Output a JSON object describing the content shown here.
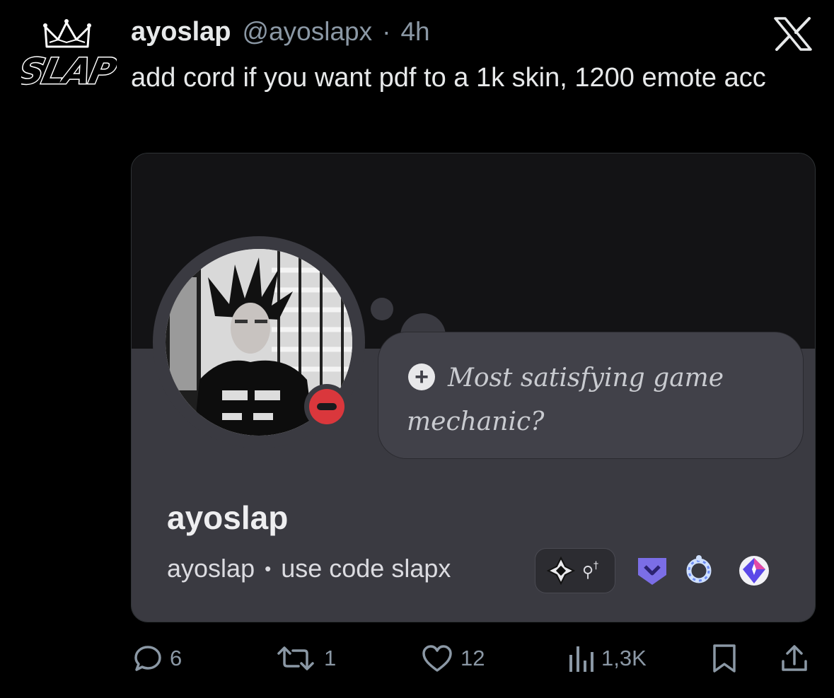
{
  "tweet": {
    "display_name": "ayoslap",
    "handle": "@ayoslapx",
    "separator": "·",
    "time": "4h",
    "text": "add cord if you want pdf to a 1k skin, 1200 emote acc"
  },
  "avatar": {
    "logo_text": "SLAP"
  },
  "profile_card": {
    "note": "Most satisfying game mechanic?",
    "name": "ayoslap",
    "username": "ayoslap",
    "bullet": "•",
    "custom_status": "use code slapx",
    "status": "do-not-disturb",
    "badges": [
      "guild-tag-icon",
      "nitro-shield-badge-icon",
      "boost-laurel-badge-icon",
      "quest-gem-badge-icon"
    ]
  },
  "actions": {
    "replies": "6",
    "reposts": "1",
    "likes": "12",
    "views": "1,3K"
  },
  "colors": {
    "background": "#000000",
    "text_primary": "#e7e9ea",
    "text_secondary": "#8b98a5",
    "card_banner": "#131315",
    "card_profile": "#3a3a41",
    "dnd_red": "#da373c"
  }
}
